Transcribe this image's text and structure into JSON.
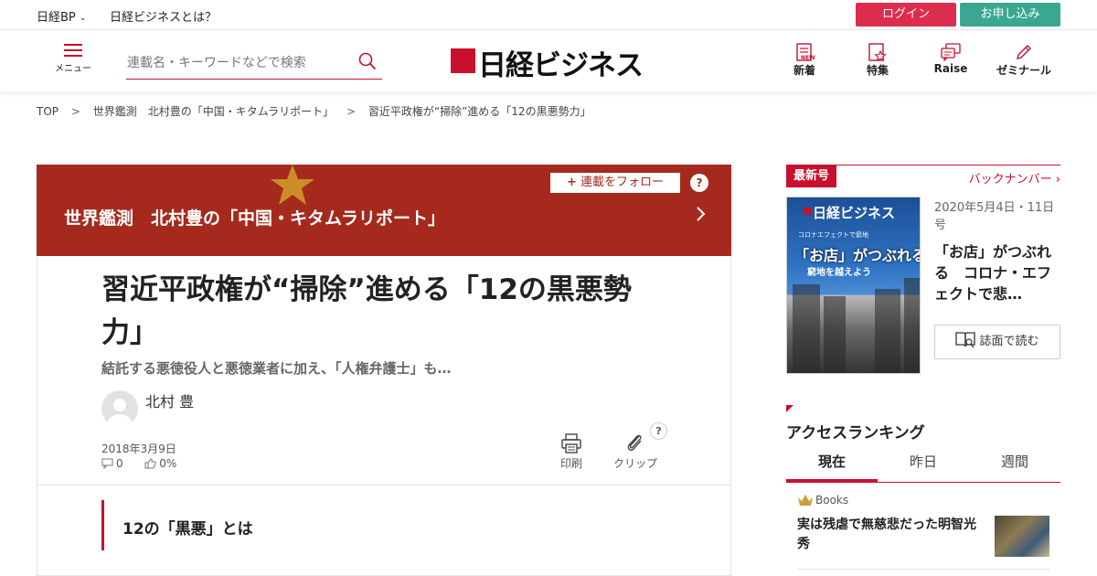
{
  "topbar": {
    "nikkei_bp": "日経BP",
    "about": "日経ビジネスとは？",
    "login": "ログイン",
    "apply": "お申し込み"
  },
  "header": {
    "menu_label": "メニュー",
    "search_placeholder": "連載名・キーワードなどで検索",
    "logo_text": "日経ビジネス",
    "nav": [
      {
        "label": "新着",
        "badge": "NEW",
        "icon": "document-icon"
      },
      {
        "label": "特集",
        "icon": "star-document-icon"
      },
      {
        "label": "Raise",
        "icon": "speech-bubbles-icon"
      },
      {
        "label": "ゼミナール",
        "icon": "pencil-icon"
      }
    ]
  },
  "breadcrumb": [
    "TOP",
    "世界鑑測　北村豊の「中国・キタムラリポート」",
    "習近平政権が“掃除”進める「12の黒悪勢力」"
  ],
  "breadcrumb_separator": ">",
  "series": {
    "title": "世界鑑測　北村豊の「中国・キタムラリポート」",
    "follow_label": "連載をフォロー",
    "help": "?"
  },
  "article": {
    "title": "習近平政権が“掃除”進める「12の黒悪勢力」",
    "subtitle": "結託する悪徳役人と悪徳業者に加え、「人権弁護士」も…",
    "author": "北村 豊",
    "date": "2018年3月9日",
    "comments": "0",
    "likes": "0%",
    "print_label": "印刷",
    "clip_label": "クリップ",
    "help": "?",
    "section_heading": "12の「黒悪」とは"
  },
  "sidebar": {
    "latest_label": "最新号",
    "backnumber_label": "バックナンバー",
    "cover": {
      "logo": "日経ビジネス",
      "line1": "コロナエフェクトで窮地",
      "line2": "「お店」がつぶれる",
      "line3": "窮地を越えよう"
    },
    "issue_date": "2020年5月4日・11日号",
    "issue_title": "「お店」がつぶれる　コロナ・エフェクトで悲…",
    "read_label": "誌面で読む",
    "ranking_title": "アクセスランキング",
    "tabs": [
      "現在",
      "昨日",
      "週間"
    ],
    "ranking_items": [
      {
        "category": "Books",
        "title": "実は残虐で無慈悲だった明智光秀"
      }
    ]
  },
  "colors": {
    "brand_red": "#c8102e",
    "login_bg": "#dc2d4e",
    "apply_bg": "#3aa891",
    "banner_bg": "#a52a1d"
  }
}
